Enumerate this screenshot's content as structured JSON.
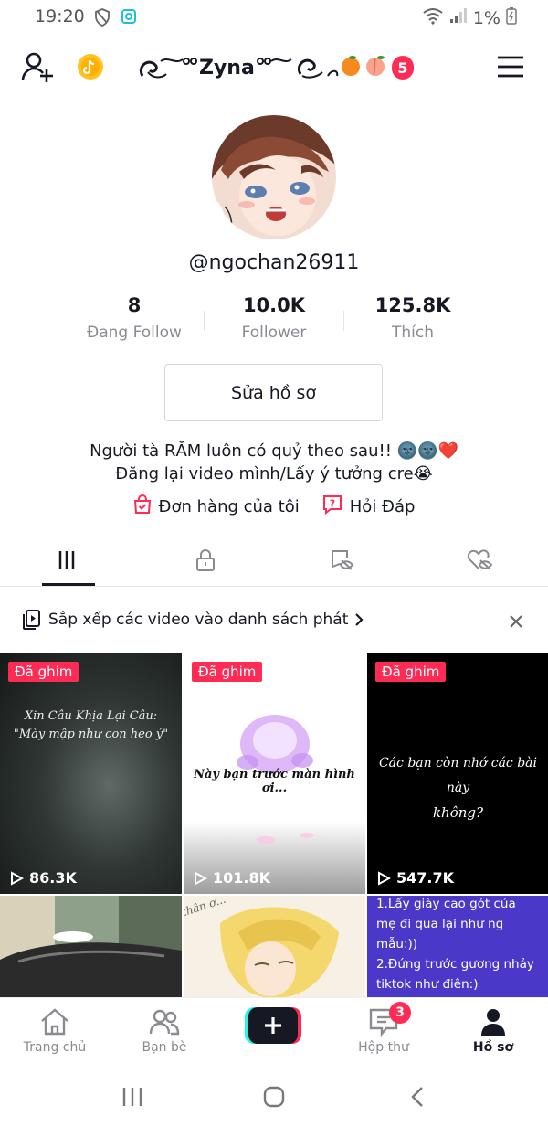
{
  "status_bar": {
    "time": "19:20",
    "battery": "1%"
  },
  "header": {
    "nickname": "Zyna",
    "notification_count": "5"
  },
  "profile": {
    "username": "@ngochan26911",
    "stats": [
      {
        "value": "8",
        "label": "Đang Follow"
      },
      {
        "value": "10.0K",
        "label": "Follower"
      },
      {
        "value": "125.8K",
        "label": "Thích"
      }
    ],
    "edit_button": "Sửa hồ sơ",
    "bio_line1": "Người tà RĂM luôn có quỷ theo sau!! 🌚🌚❤️",
    "bio_line2": "Đăng lại video mình/Lấy ý tưởng cre😭",
    "links": {
      "orders": "Đơn hàng của tôi",
      "qa": "Hỏi Đáp"
    }
  },
  "playlist_banner": "Sắp xếp các video vào danh sách phát",
  "videos": [
    {
      "pinned": "Đã ghim",
      "views": "86.3K",
      "caption_line1": "Xin Câu Khịa Lại Câu:",
      "caption_line2": "\"Mày mập như con heo ý\""
    },
    {
      "pinned": "Đã ghim",
      "views": "101.8K",
      "caption_line1": "Này bạn trước màn hình ơi..."
    },
    {
      "pinned": "Đã ghim",
      "views": "547.7K",
      "caption_line1": "Các bạn còn nhớ các bài này",
      "caption_line2": "không?"
    },
    {
      "caption_line1": "thân ơ..."
    },
    {
      "caption_line1": "1.Lấy giày cao gót của",
      "caption_line2": "mẹ đi qua lại như ng",
      "caption_line3": "mẫu:))",
      "caption_line4": "2.Đứng trước gương nhảy",
      "caption_line5": "tiktok như điên:)"
    }
  ],
  "bottom_nav": {
    "home": "Trang chủ",
    "friends": "Bạn bè",
    "inbox": "Hộp thư",
    "inbox_badge": "3",
    "profile": "Hồ sơ"
  },
  "colors": {
    "accent": "#fe2c55",
    "cyan": "#25f4ee",
    "text": "#161823",
    "muted": "#8a8b91"
  }
}
